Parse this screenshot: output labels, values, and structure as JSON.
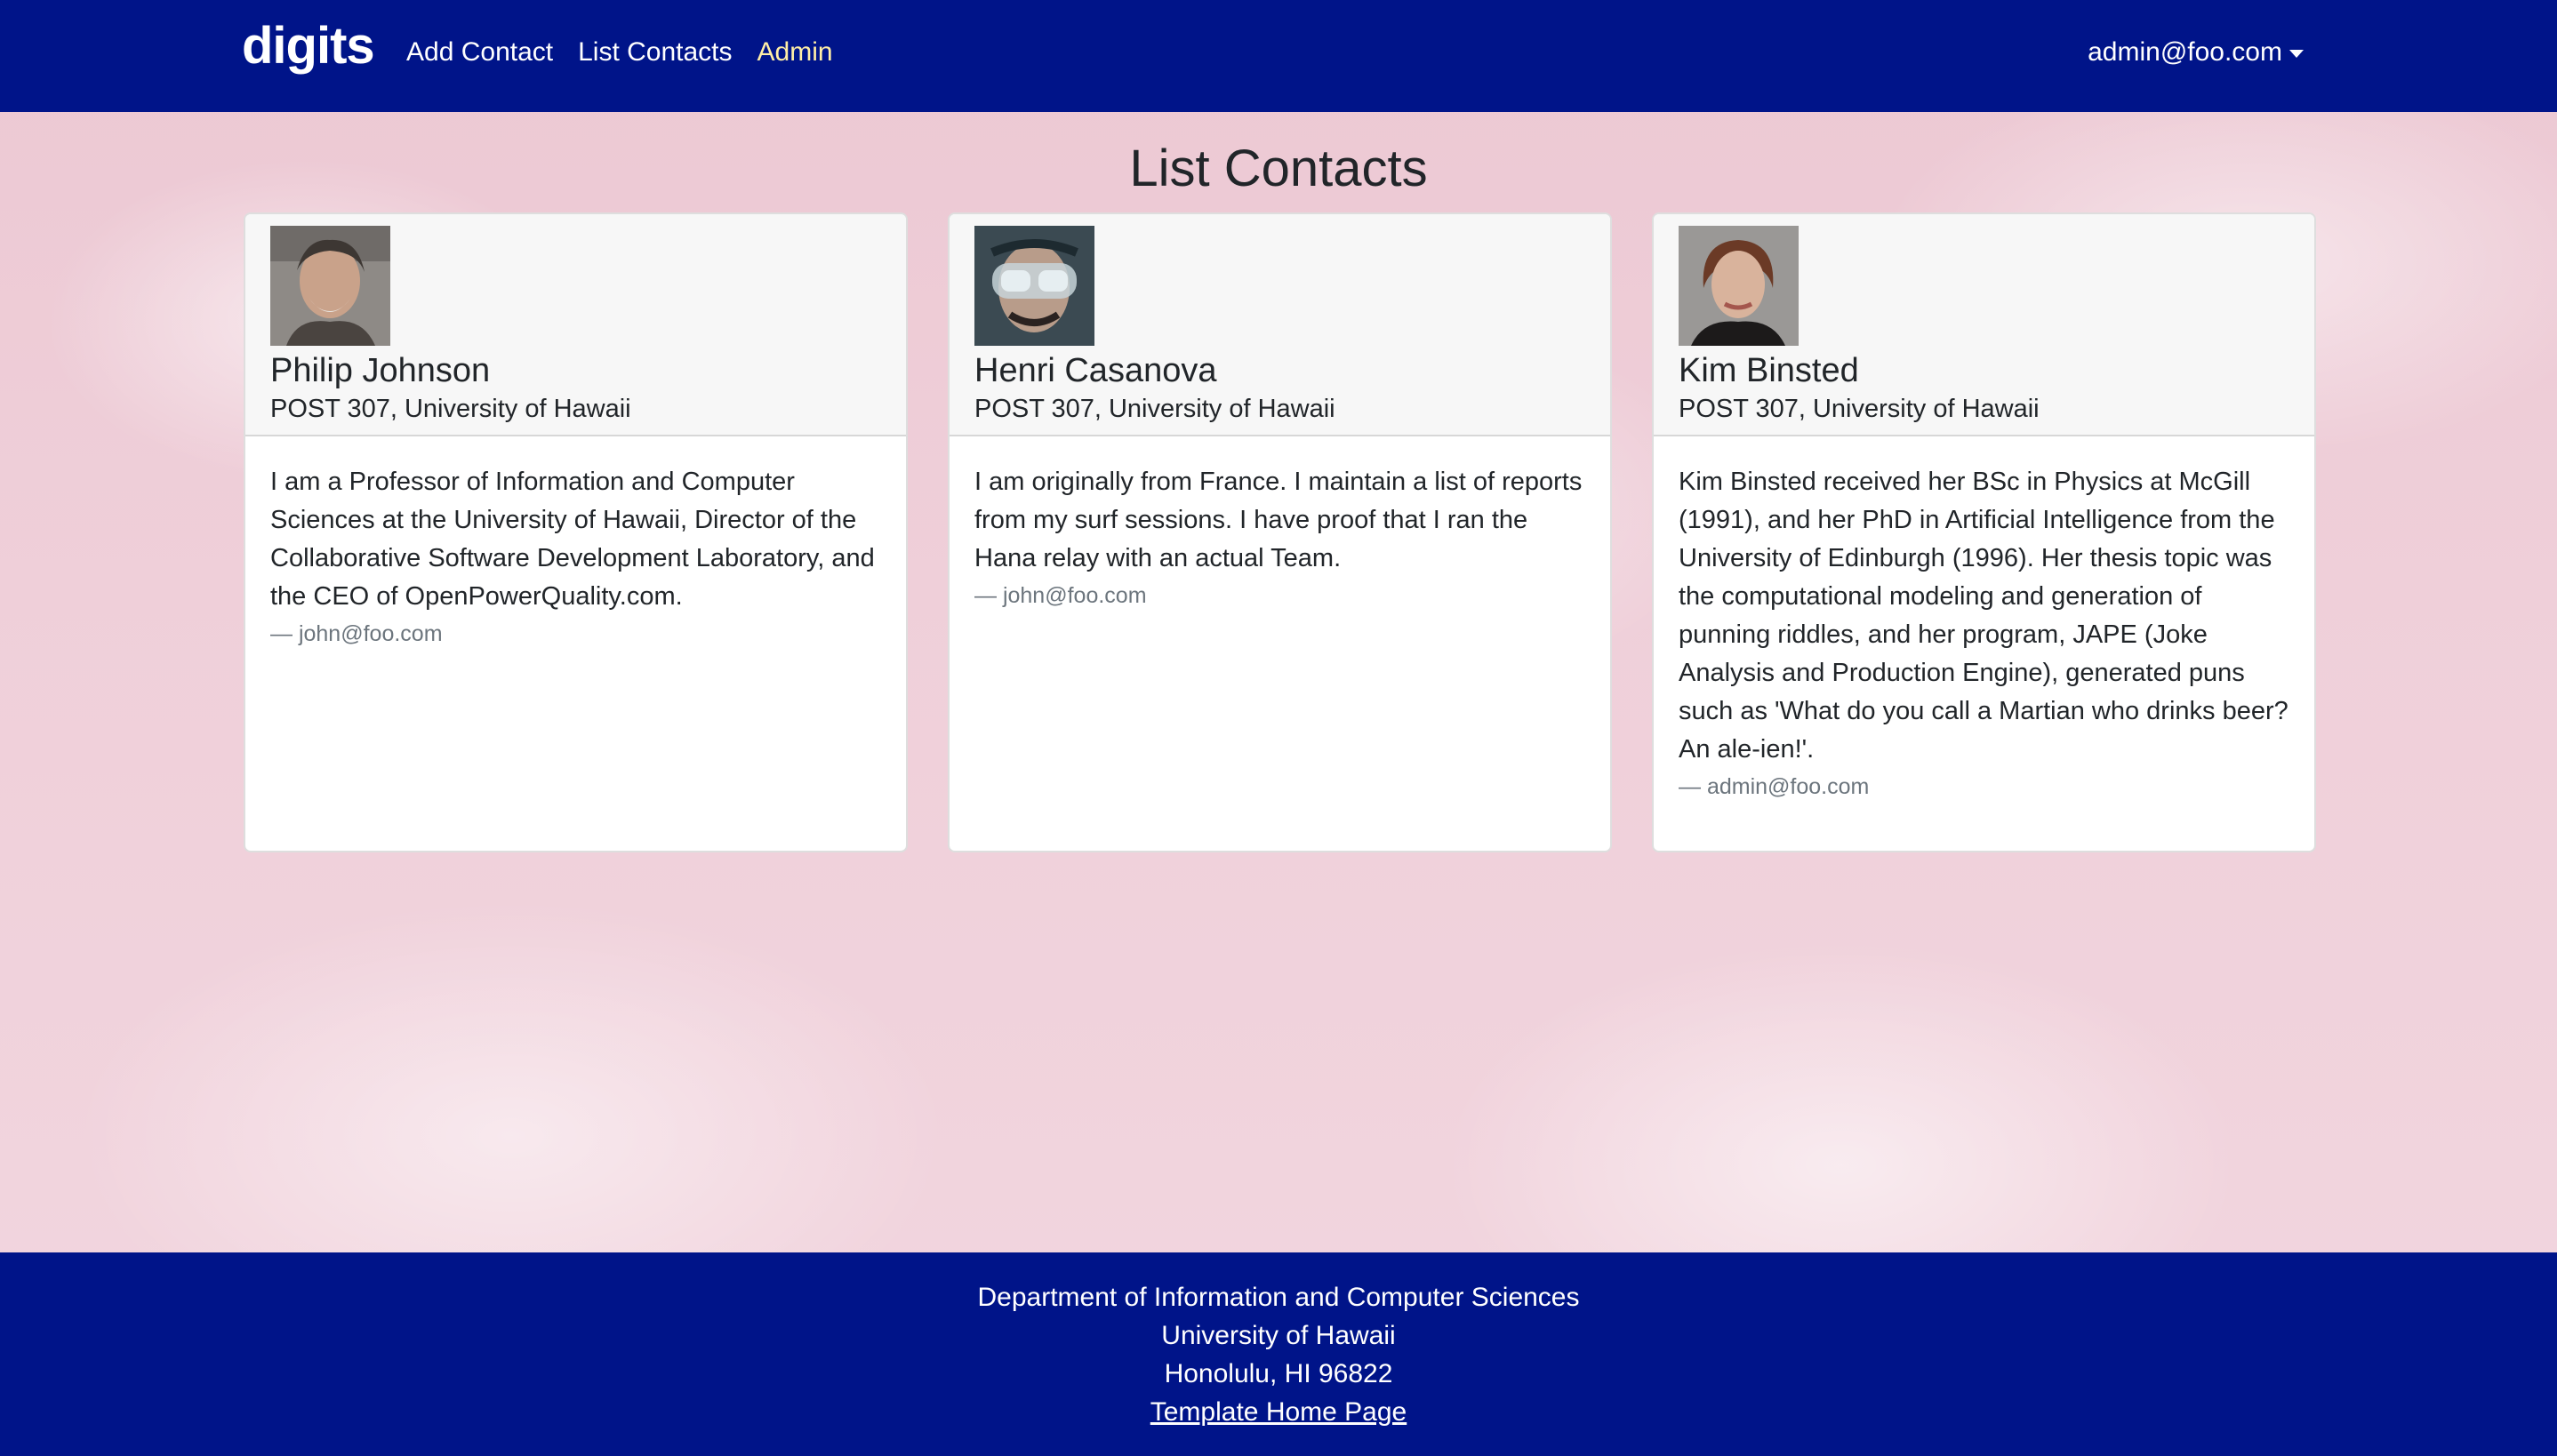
{
  "nav": {
    "brand": "digits",
    "links": [
      {
        "label": "Add Contact"
      },
      {
        "label": "List Contacts"
      },
      {
        "label": "Admin"
      }
    ],
    "user": "admin@foo.com",
    "accent_color": "#ffeea6",
    "bg_color": "#001489"
  },
  "page": {
    "title": "List Contacts"
  },
  "contacts": [
    {
      "name": "Philip Johnson",
      "address": "POST 307, University of Hawaii",
      "description": "I am a Professor of Information and Computer Sciences at the University of Hawaii, Director of the Collaborative Software Development Laboratory, and the CEO of OpenPowerQuality.com.",
      "owner": "— john@foo.com",
      "avatar_icon": "person-photo-icon"
    },
    {
      "name": "Henri Casanova",
      "address": "POST 307, University of Hawaii",
      "description": "I am originally from France. I maintain a list of reports from my surf sessions. I have proof that I ran the Hana relay with an actual Team.",
      "owner": "— john@foo.com",
      "avatar_icon": "person-photo-icon"
    },
    {
      "name": "Kim Binsted",
      "address": "POST 307, University of Hawaii",
      "description": "Kim Binsted received her BSc in Physics at McGill (1991), and her PhD in Artificial Intelligence from the University of Edinburgh (1996). Her thesis topic was the computational modeling and generation of punning riddles, and her program, JAPE (Joke Analysis and Production Engine), generated puns such as 'What do you call a Martian who drinks beer? An ale-ien!'.",
      "owner": "— admin@foo.com",
      "avatar_icon": "person-photo-icon"
    }
  ],
  "footer": {
    "line1": "Department of Information and Computer Sciences",
    "line2": "University of Hawaii",
    "line3": "Honolulu, HI 96822",
    "link": "Template Home Page"
  }
}
